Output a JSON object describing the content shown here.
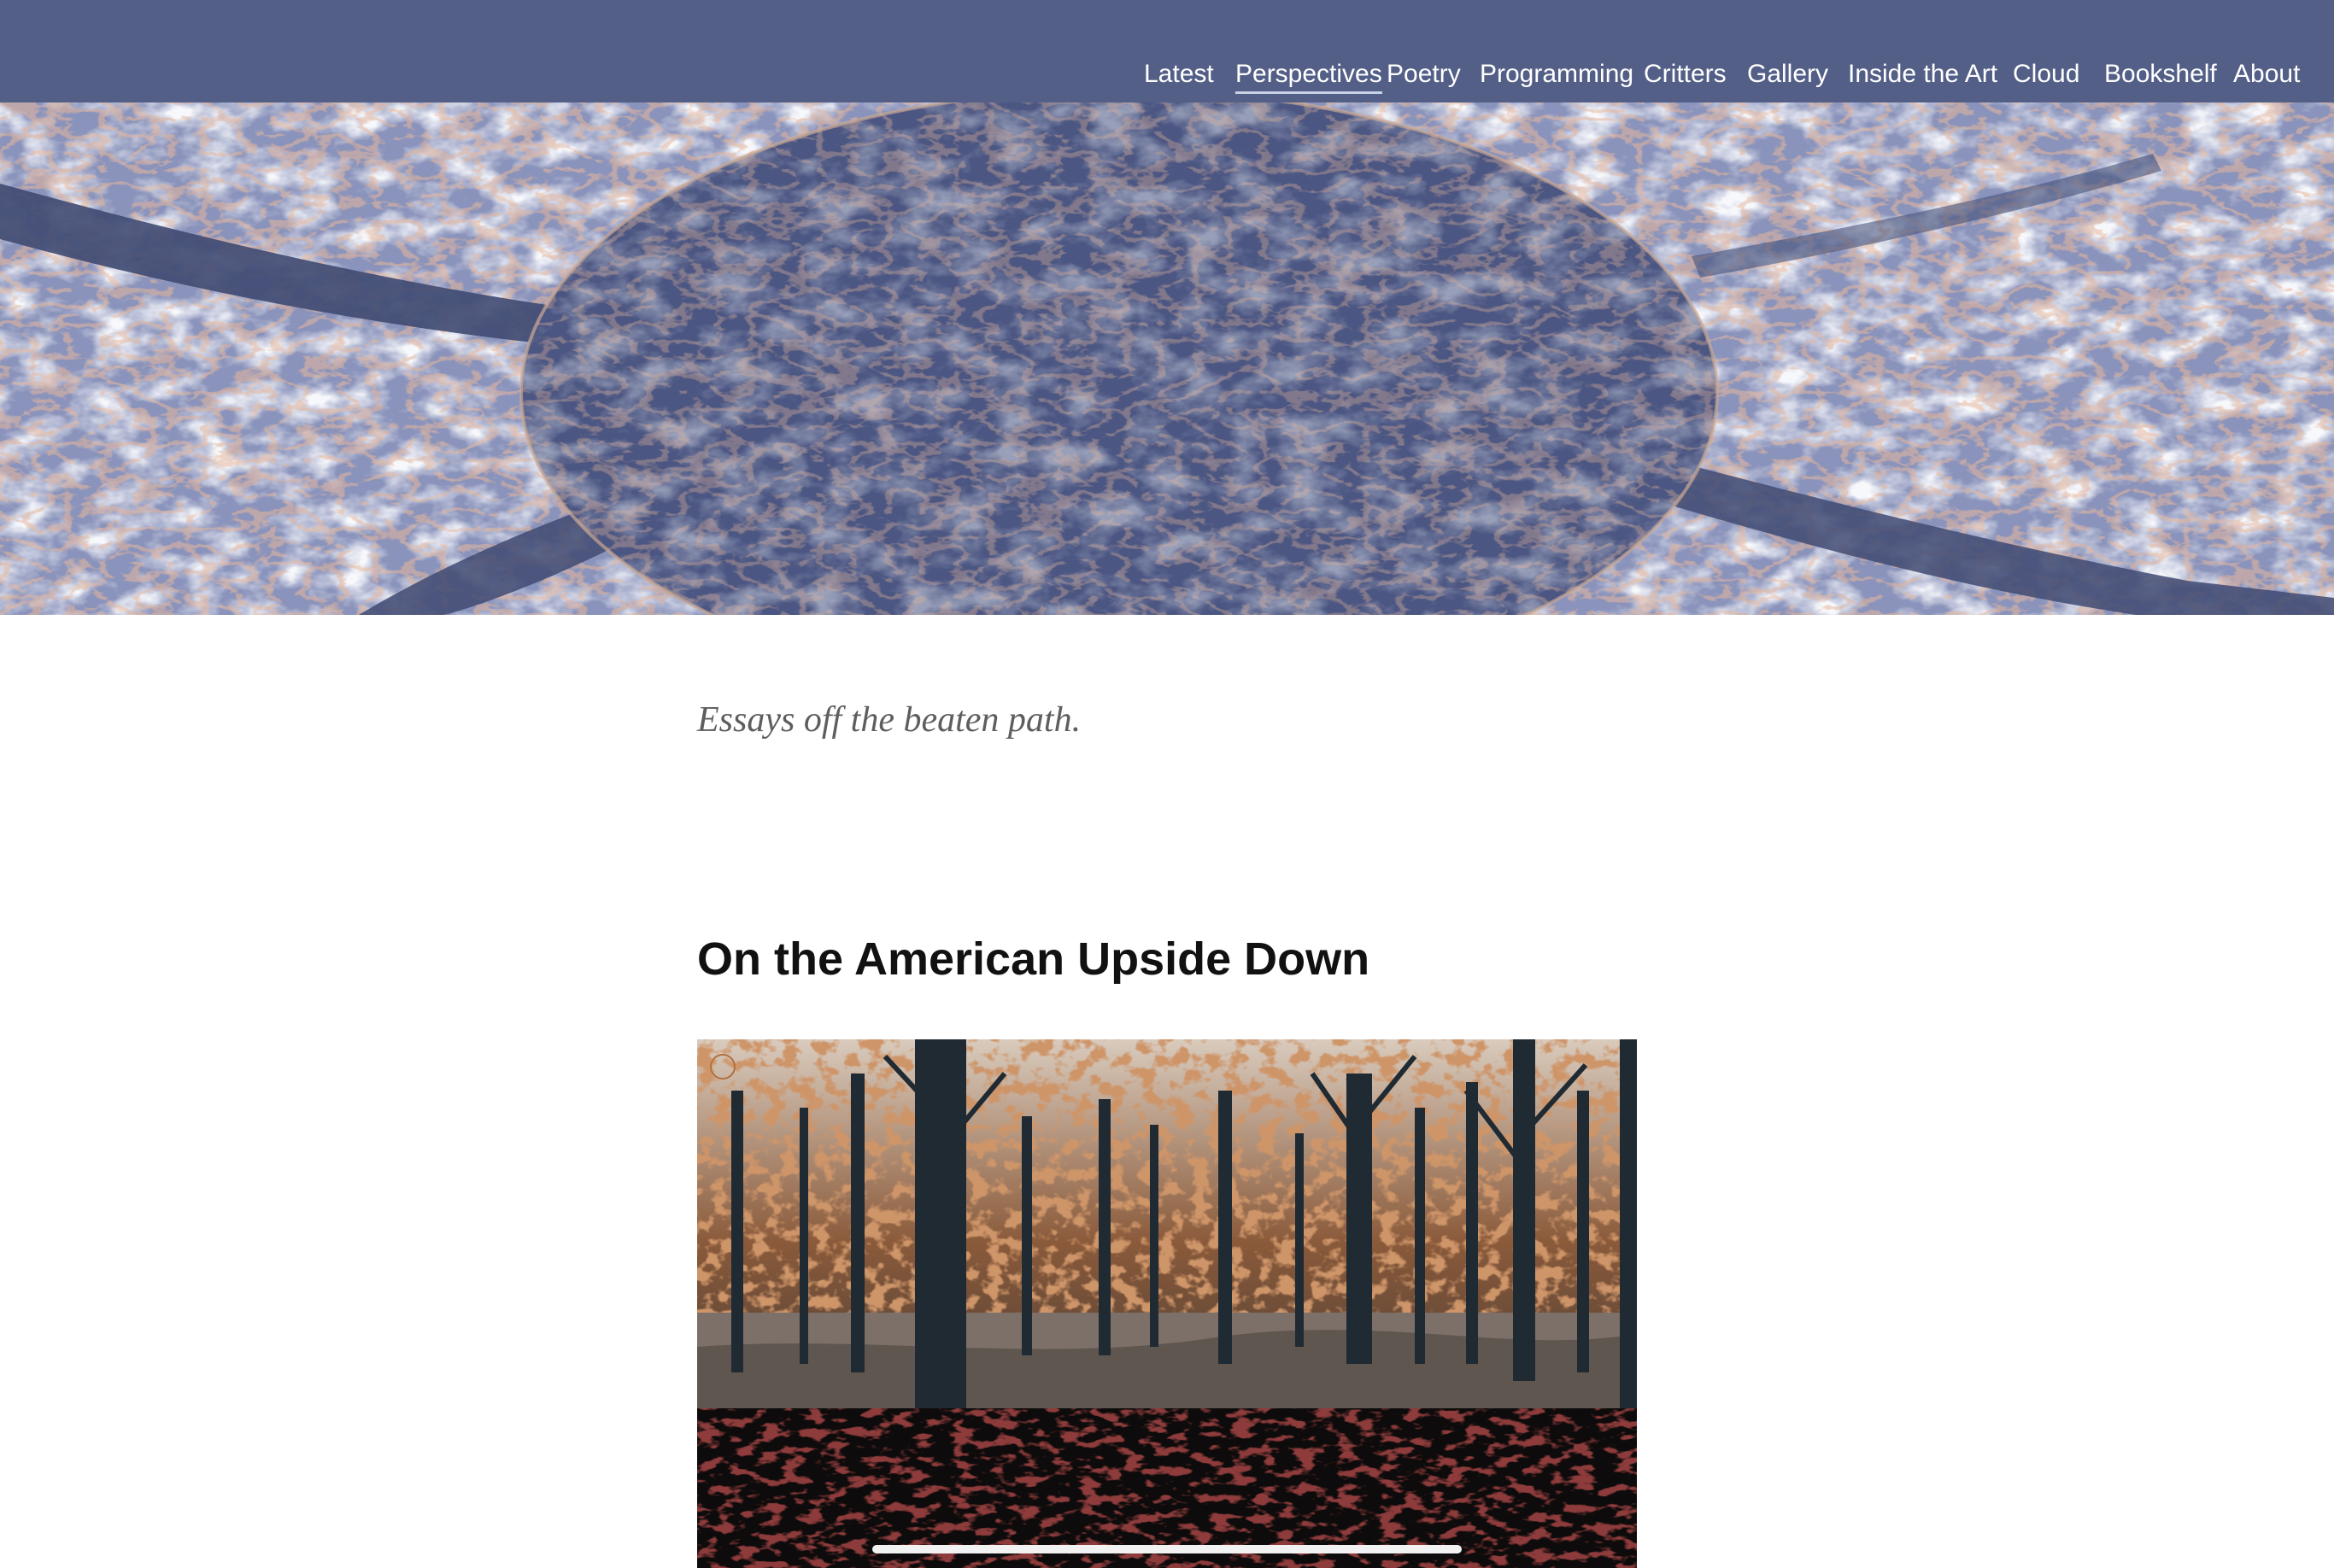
{
  "nav": {
    "items": [
      {
        "label": "Latest"
      },
      {
        "label": "Perspectives",
        "active": true
      },
      {
        "label": "Poetry"
      },
      {
        "label": "Programming"
      },
      {
        "label": "Critters"
      },
      {
        "label": "Gallery"
      },
      {
        "label": "Inside the Art"
      },
      {
        "label": "Cloud"
      },
      {
        "label": "Bookshelf"
      },
      {
        "label": "About"
      }
    ]
  },
  "page": {
    "tagline": "Essays off the beaten path."
  },
  "post": {
    "title": "On the American Upside Down"
  },
  "colors": {
    "nav_background": "#535f86",
    "nav_text": "#ffffff",
    "title_text": "#111111",
    "tagline_text": "#5e5e5e"
  }
}
